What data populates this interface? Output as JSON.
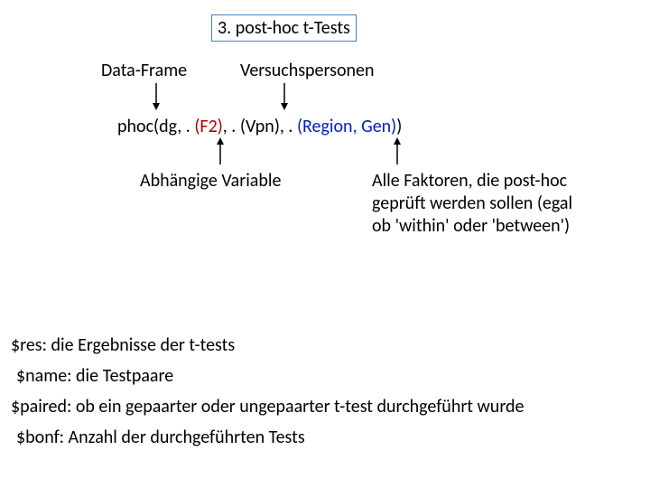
{
  "title": "3. post-hoc t-Tests",
  "labels": {
    "dataframe": "Data-Frame",
    "versuchspersonen": "Versuchspersonen"
  },
  "code": {
    "p1": "phoc(dg, . ",
    "p2": "(F2)",
    "p3": ", . ",
    "p4": "(Vpn)",
    "p5": ", . ",
    "p6": "(Region, Gen)",
    "p7": ")"
  },
  "annot": {
    "dependent": "Abhängige Variable",
    "factors": "Alle Faktoren, die post-hoc geprüft werden sollen (egal ob 'within' oder 'between')"
  },
  "results": {
    "res": "$res: die Ergebnisse der t-tests",
    "name": "$name: die Testpaare",
    "paired": "$paired: ob ein gepaarter oder ungepaarter t-test durchgeführt wurde",
    "bonf": "$bonf: Anzahl der durchgeführten Tests"
  }
}
